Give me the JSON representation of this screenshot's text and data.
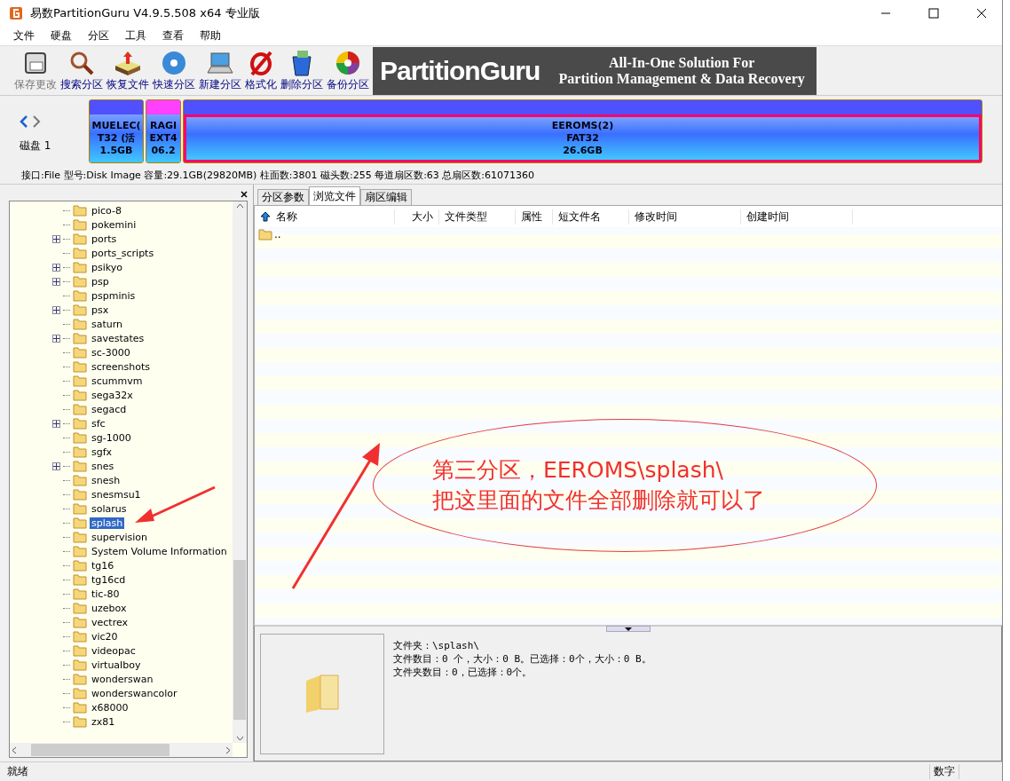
{
  "window": {
    "title": "易数PartitionGuru V4.9.5.508 x64 专业版"
  },
  "menu": [
    "文件",
    "硬盘",
    "分区",
    "工具",
    "查看",
    "帮助"
  ],
  "toolbar": [
    {
      "label": "保存更改",
      "kind": "save",
      "disabled": true
    },
    {
      "label": "搜索分区",
      "kind": "search",
      "disabled": false
    },
    {
      "label": "恢复文件",
      "kind": "recover",
      "disabled": false
    },
    {
      "label": "快速分区",
      "kind": "quick",
      "disabled": false
    },
    {
      "label": "新建分区",
      "kind": "new",
      "disabled": false
    },
    {
      "label": "格式化",
      "kind": "format",
      "disabled": false
    },
    {
      "label": "删除分区",
      "kind": "delete",
      "disabled": false
    },
    {
      "label": "备份分区",
      "kind": "backup",
      "disabled": false
    }
  ],
  "banner": {
    "logo": "PartitionGuru",
    "tagline_1": "All-In-One Solution For",
    "tagline_2": "Partition Management & Data Recovery"
  },
  "disk": {
    "label": "磁盘 1",
    "partitions": [
      {
        "lines": [
          "MUELEC(",
          "T32 (活",
          "1.5GB"
        ],
        "color": "#5050ff",
        "selected": false
      },
      {
        "lines": [
          "RAGI",
          "EXT4",
          "06.2"
        ],
        "color": "#ff40ff",
        "selected": false
      },
      {
        "lines": [
          "EEROMS(2)",
          "FAT32",
          "26.6GB"
        ],
        "color": "#5050ff",
        "selected": true
      }
    ],
    "info": "接口:File  型号:Disk Image  容量:29.1GB(29820MB)  柱面数:3801  磁头数:255  每道扇区数:63  总扇区数:61071360"
  },
  "tree": [
    {
      "name": "pico-8",
      "expandable": false,
      "selected": false
    },
    {
      "name": "pokemini",
      "expandable": false,
      "selected": false
    },
    {
      "name": "ports",
      "expandable": true,
      "selected": false
    },
    {
      "name": "ports_scripts",
      "expandable": false,
      "selected": false
    },
    {
      "name": "psikyo",
      "expandable": true,
      "selected": false
    },
    {
      "name": "psp",
      "expandable": true,
      "selected": false
    },
    {
      "name": "pspminis",
      "expandable": false,
      "selected": false
    },
    {
      "name": "psx",
      "expandable": true,
      "selected": false
    },
    {
      "name": "saturn",
      "expandable": false,
      "selected": false
    },
    {
      "name": "savestates",
      "expandable": true,
      "selected": false
    },
    {
      "name": "sc-3000",
      "expandable": false,
      "selected": false
    },
    {
      "name": "screenshots",
      "expandable": false,
      "selected": false
    },
    {
      "name": "scummvm",
      "expandable": false,
      "selected": false
    },
    {
      "name": "sega32x",
      "expandable": false,
      "selected": false
    },
    {
      "name": "segacd",
      "expandable": false,
      "selected": false
    },
    {
      "name": "sfc",
      "expandable": true,
      "selected": false
    },
    {
      "name": "sg-1000",
      "expandable": false,
      "selected": false
    },
    {
      "name": "sgfx",
      "expandable": false,
      "selected": false
    },
    {
      "name": "snes",
      "expandable": true,
      "selected": false
    },
    {
      "name": "snesh",
      "expandable": false,
      "selected": false
    },
    {
      "name": "snesmsu1",
      "expandable": false,
      "selected": false
    },
    {
      "name": "solarus",
      "expandable": false,
      "selected": false
    },
    {
      "name": "splash",
      "expandable": false,
      "selected": true
    },
    {
      "name": "supervision",
      "expandable": false,
      "selected": false
    },
    {
      "name": "System Volume Information",
      "expandable": false,
      "selected": false
    },
    {
      "name": "tg16",
      "expandable": false,
      "selected": false
    },
    {
      "name": "tg16cd",
      "expandable": false,
      "selected": false
    },
    {
      "name": "tic-80",
      "expandable": false,
      "selected": false
    },
    {
      "name": "uzebox",
      "expandable": false,
      "selected": false
    },
    {
      "name": "vectrex",
      "expandable": false,
      "selected": false
    },
    {
      "name": "vic20",
      "expandable": false,
      "selected": false
    },
    {
      "name": "videopac",
      "expandable": false,
      "selected": false
    },
    {
      "name": "virtualboy",
      "expandable": false,
      "selected": false
    },
    {
      "name": "wonderswan",
      "expandable": false,
      "selected": false
    },
    {
      "name": "wonderswancolor",
      "expandable": false,
      "selected": false
    },
    {
      "name": "x68000",
      "expandable": false,
      "selected": false
    },
    {
      "name": "zx81",
      "expandable": false,
      "selected": false
    }
  ],
  "tabs": [
    {
      "label": "分区参数",
      "selected": false
    },
    {
      "label": "浏览文件",
      "selected": true
    },
    {
      "label": "扇区编辑",
      "selected": false
    }
  ],
  "table": {
    "columns": [
      "名称",
      "大小",
      "文件类型",
      "属性",
      "短文件名",
      "修改时间",
      "创建时间"
    ],
    "rows": [
      {
        "name": ".."
      }
    ]
  },
  "details": {
    "lines": [
      "文件夹：\\splash\\",
      "文件数目：0 个，大小：0 B。已选择：0个，大小：0 B。",
      "文件夹数目：0，已选择：0个。"
    ]
  },
  "annotation": {
    "line_1": "第三分区，EEROMS\\splash\\",
    "line_2": "把这里面的文件全部删除就可以了"
  },
  "status_bar": {
    "message": "就绪",
    "indicator": "数字"
  }
}
